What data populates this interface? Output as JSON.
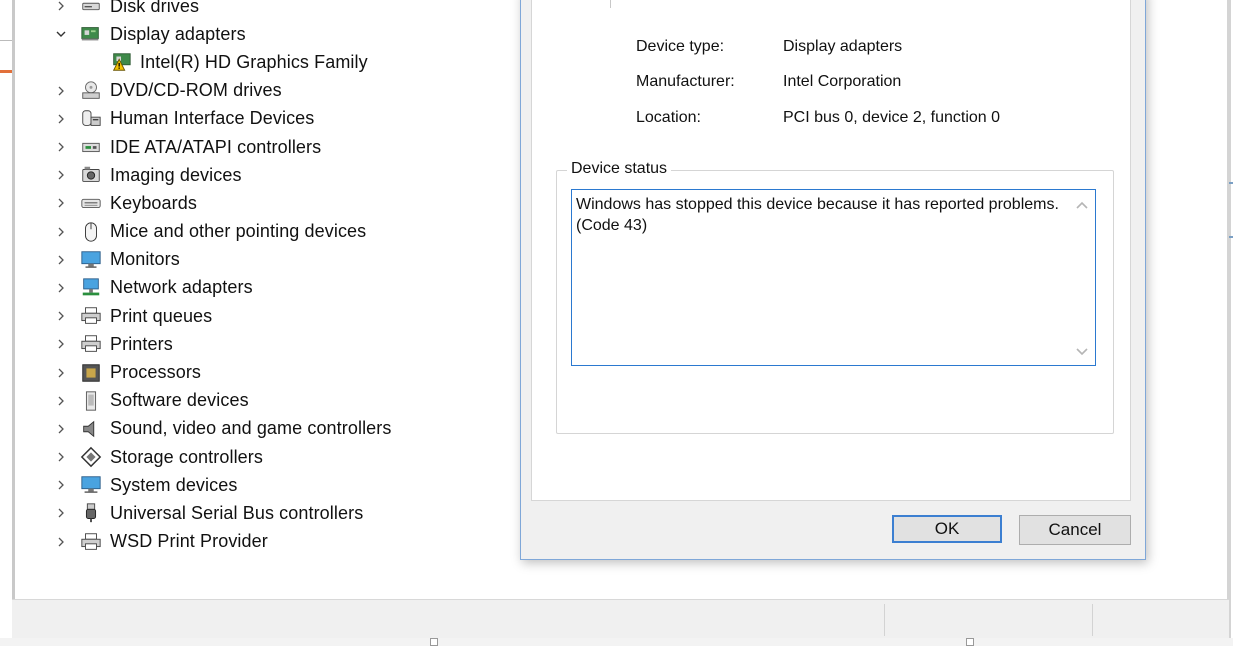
{
  "tree": {
    "items": [
      {
        "label": "Disk drives",
        "icon": "disk-drive-icon",
        "expanded": false
      },
      {
        "label": "Display adapters",
        "icon": "display-adapter-icon",
        "expanded": true
      },
      {
        "label": "Intel(R) HD Graphics Family",
        "icon": "warning-adapter-icon",
        "child": true
      },
      {
        "label": "DVD/CD-ROM drives",
        "icon": "dvd-drive-icon"
      },
      {
        "label": "Human Interface Devices",
        "icon": "hid-icon"
      },
      {
        "label": "IDE ATA/ATAPI controllers",
        "icon": "ide-controller-icon"
      },
      {
        "label": "Imaging devices",
        "icon": "camera-icon"
      },
      {
        "label": "Keyboards",
        "icon": "keyboard-icon"
      },
      {
        "label": "Mice and other pointing devices",
        "icon": "mouse-icon"
      },
      {
        "label": "Monitors",
        "icon": "monitor-icon"
      },
      {
        "label": "Network adapters",
        "icon": "network-icon"
      },
      {
        "label": "Print queues",
        "icon": "printer-icon"
      },
      {
        "label": "Printers",
        "icon": "printer-icon"
      },
      {
        "label": "Processors",
        "icon": "processor-icon"
      },
      {
        "label": "Software devices",
        "icon": "software-device-icon"
      },
      {
        "label": "Sound, video and game controllers",
        "icon": "speaker-icon"
      },
      {
        "label": "Storage controllers",
        "icon": "storage-controller-icon"
      },
      {
        "label": "System devices",
        "icon": "system-device-icon"
      },
      {
        "label": "Universal Serial Bus controllers",
        "icon": "usb-icon"
      },
      {
        "label": "WSD Print Provider",
        "icon": "printer-icon"
      }
    ]
  },
  "dialog": {
    "device_type_label": "Device type:",
    "device_type_value": "Display adapters",
    "manufacturer_label": "Manufacturer:",
    "manufacturer_value": "Intel Corporation",
    "location_label": "Location:",
    "location_value": "PCI bus 0, device 2, function 0",
    "status_group_title": "Device status",
    "status_text": "Windows has stopped this device because it has reported problems. (Code 43)",
    "ok_label": "OK",
    "cancel_label": "Cancel"
  },
  "colors": {
    "accent_blue": "#2b79d0",
    "dialog_bg": "#f0f0f0",
    "warning_yellow": "#f2c200"
  }
}
